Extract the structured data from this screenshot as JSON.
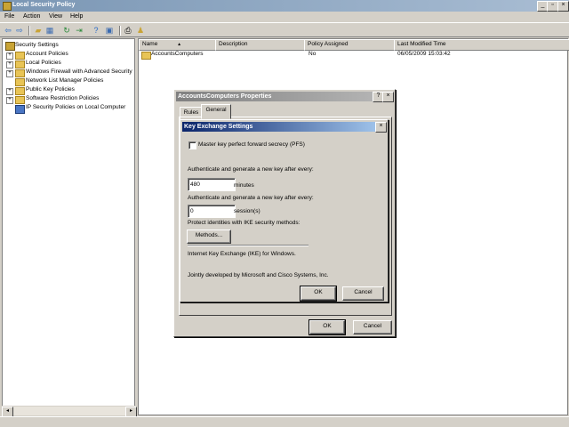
{
  "window": {
    "title": "Local Security Policy",
    "minimize_glyph": "_",
    "restore_glyph": "▫",
    "close_glyph": "×"
  },
  "menu": [
    "File",
    "Action",
    "View",
    "Help"
  ],
  "toolbar_icons": [
    "back-arrow-icon",
    "forward-arrow-icon",
    "up-folder-icon",
    "properties-icon",
    "refresh-icon",
    "export-icon",
    "help-icon",
    "assign-policy-icon",
    "properties-sheet-icon",
    "user-icon"
  ],
  "tree": {
    "root": "Security Settings",
    "items": [
      {
        "label": "Account Policies",
        "expand": "+"
      },
      {
        "label": "Local Policies",
        "expand": "+"
      },
      {
        "label": "Windows Firewall with Advanced Security",
        "expand": "+"
      },
      {
        "label": "Network List Manager Policies",
        "expand": ""
      },
      {
        "label": "Public Key Policies",
        "expand": "+"
      },
      {
        "label": "Software Restriction Policies",
        "expand": "+"
      },
      {
        "label": "IP Security Policies on Local Computer",
        "expand": ""
      }
    ]
  },
  "list": {
    "columns": [
      "Name",
      "Description",
      "Policy Assigned",
      "Last Modified Time"
    ],
    "sort_glyph": "▲",
    "rows": [
      {
        "name": "AccountsComputers",
        "description": "",
        "assigned": "No",
        "modified": "06/05/2009 15:03:42"
      }
    ]
  },
  "scroll": {
    "left_glyph": "◂",
    "right_glyph": "▸"
  },
  "properties_dialog": {
    "title": "AccountsComputers Properties",
    "help_glyph": "?",
    "close_glyph": "×",
    "tabs": [
      "Rules",
      "General"
    ],
    "ok": "OK",
    "cancel": "Cancel"
  },
  "key_exchange_dialog": {
    "title": "Key Exchange Settings",
    "close_glyph": "×",
    "pfs_label": "Master key perfect forward secrecy (PFS)",
    "pfs_checked": false,
    "minutes_prompt": "Authenticate and generate a new key after every:",
    "minutes_value": "480",
    "minutes_unit": "minutes",
    "sessions_prompt": "Authenticate and generate a new key after every:",
    "sessions_value": "0",
    "sessions_unit": "session(s)",
    "protect_label": "Protect identities with IKE security methods:",
    "methods_button": "Methods...",
    "ike_note": "Internet Key Exchange (IKE) for Windows.",
    "developed_note": "Jointly developed by Microsoft and Cisco Systems, Inc.",
    "ok": "OK",
    "cancel": "Cancel"
  }
}
